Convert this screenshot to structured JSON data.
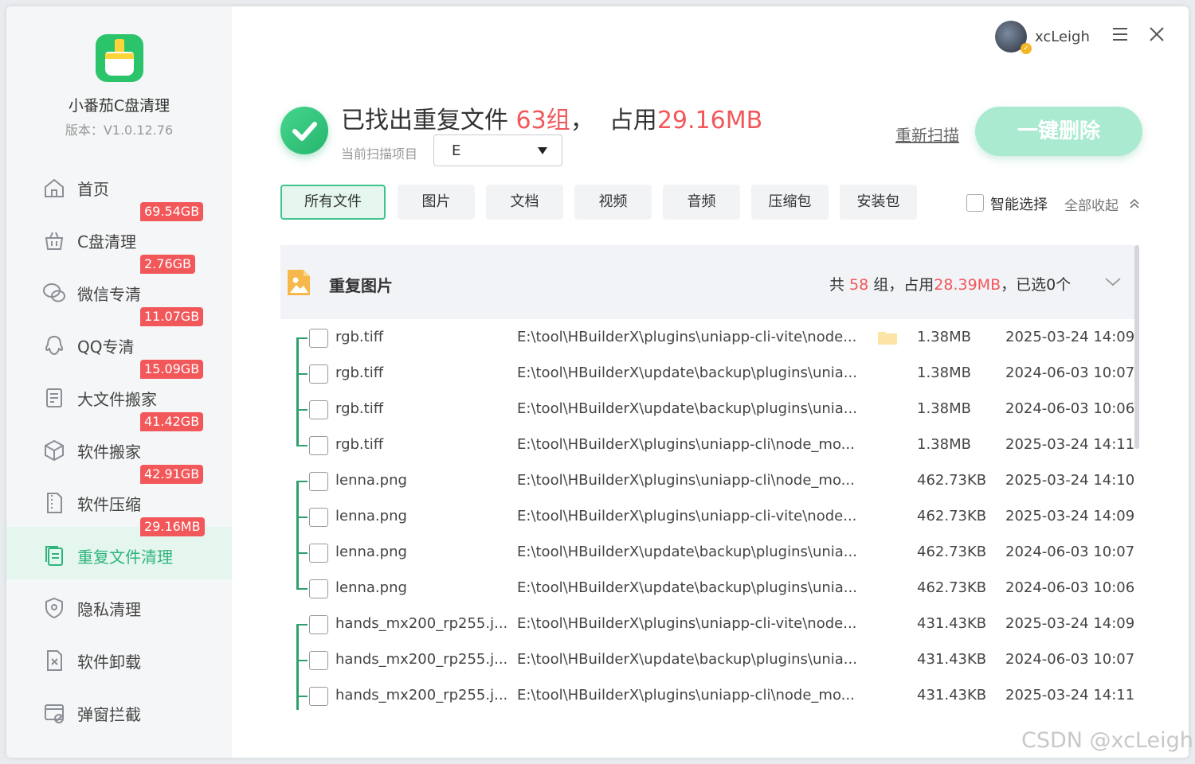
{
  "app": {
    "name": "小番茄C盘清理",
    "version": "版本：V1.0.12.76"
  },
  "sidebar": {
    "items": [
      {
        "label": "首页",
        "icon": "home-icon",
        "badge": ""
      },
      {
        "label": "C盘清理",
        "icon": "basket-icon",
        "badge": "69.54GB"
      },
      {
        "label": "微信专清",
        "icon": "wechat-icon",
        "badge": "2.76GB"
      },
      {
        "label": "QQ专清",
        "icon": "qq-icon",
        "badge": "11.07GB"
      },
      {
        "label": "大文件搬家",
        "icon": "big-file-icon",
        "badge": "15.09GB"
      },
      {
        "label": "软件搬家",
        "icon": "box-move-icon",
        "badge": "41.42GB"
      },
      {
        "label": "软件压缩",
        "icon": "zip-file-icon",
        "badge": "42.91GB"
      },
      {
        "label": "重复文件清理",
        "icon": "duplicate-files-icon",
        "badge": "29.16MB",
        "active": true
      },
      {
        "label": "隐私清理",
        "icon": "shield-icon",
        "badge": ""
      },
      {
        "label": "软件卸载",
        "icon": "uninstall-icon",
        "badge": ""
      },
      {
        "label": "弹窗拦截",
        "icon": "popup-block-icon",
        "badge": ""
      }
    ]
  },
  "user": {
    "name": "xcLeigh"
  },
  "summary": {
    "prefix": "已找出重复文件",
    "groups": "63组",
    "sep": "，",
    "occupy": "占用",
    "size": "29.16MB",
    "scan_label": "当前扫描项目",
    "scan_value": "E",
    "rescan": "重新扫描",
    "delete_all": "一键删除"
  },
  "tabs": [
    {
      "label": "所有文件",
      "active": true
    },
    {
      "label": "图片"
    },
    {
      "label": "文档"
    },
    {
      "label": "视频"
    },
    {
      "label": "音频"
    },
    {
      "label": "压缩包"
    },
    {
      "label": "安装包"
    }
  ],
  "filters": {
    "smart_select": "智能选择",
    "collapse_all": "全部收起"
  },
  "group": {
    "title": "重复图片",
    "stats_prefix": "共 ",
    "stats_count": "58",
    "stats_mid": " 组，占用",
    "stats_size": "28.39MB",
    "stats_suffix": "，已选0个"
  },
  "files": [
    {
      "name": "rgb.tiff",
      "path": "E:\\tool\\HBuilderX\\plugins\\uniapp-cli-vite\\node...",
      "size": "1.38MB",
      "date": "2025-03-24 14:09",
      "folder": true
    },
    {
      "name": "rgb.tiff",
      "path": "E:\\tool\\HBuilderX\\update\\backup\\plugins\\unia...",
      "size": "1.38MB",
      "date": "2024-06-03 10:07"
    },
    {
      "name": "rgb.tiff",
      "path": "E:\\tool\\HBuilderX\\update\\backup\\plugins\\unia...",
      "size": "1.38MB",
      "date": "2024-06-03 10:06"
    },
    {
      "name": "rgb.tiff",
      "path": "E:\\tool\\HBuilderX\\plugins\\uniapp-cli\\node_mo...",
      "size": "1.38MB",
      "date": "2025-03-24 14:11"
    },
    {
      "name": "lenna.png",
      "path": "E:\\tool\\HBuilderX\\plugins\\uniapp-cli\\node_mo...",
      "size": "462.73KB",
      "date": "2025-03-24 14:10"
    },
    {
      "name": "lenna.png",
      "path": "E:\\tool\\HBuilderX\\plugins\\uniapp-cli-vite\\node...",
      "size": "462.73KB",
      "date": "2025-03-24 14:09"
    },
    {
      "name": "lenna.png",
      "path": "E:\\tool\\HBuilderX\\update\\backup\\plugins\\unia...",
      "size": "462.73KB",
      "date": "2024-06-03 10:07"
    },
    {
      "name": "lenna.png",
      "path": "E:\\tool\\HBuilderX\\update\\backup\\plugins\\unia...",
      "size": "462.73KB",
      "date": "2024-06-03 10:06"
    },
    {
      "name": "hands_mx200_rp255.j...",
      "path": "E:\\tool\\HBuilderX\\plugins\\uniapp-cli-vite\\node...",
      "size": "431.43KB",
      "date": "2025-03-24 14:09"
    },
    {
      "name": "hands_mx200_rp255.j...",
      "path": "E:\\tool\\HBuilderX\\update\\backup\\plugins\\unia...",
      "size": "431.43KB",
      "date": "2024-06-03 10:07"
    },
    {
      "name": "hands_mx200_rp255.j...",
      "path": "E:\\tool\\HBuilderX\\plugins\\uniapp-cli\\node_mo...",
      "size": "431.43KB",
      "date": "2025-03-24 14:11"
    }
  ],
  "watermark": "CSDN @xcLeigh",
  "colors": {
    "accent": "#2fb57c",
    "danger": "#f2575a",
    "delete_button": "#a9ead0"
  }
}
